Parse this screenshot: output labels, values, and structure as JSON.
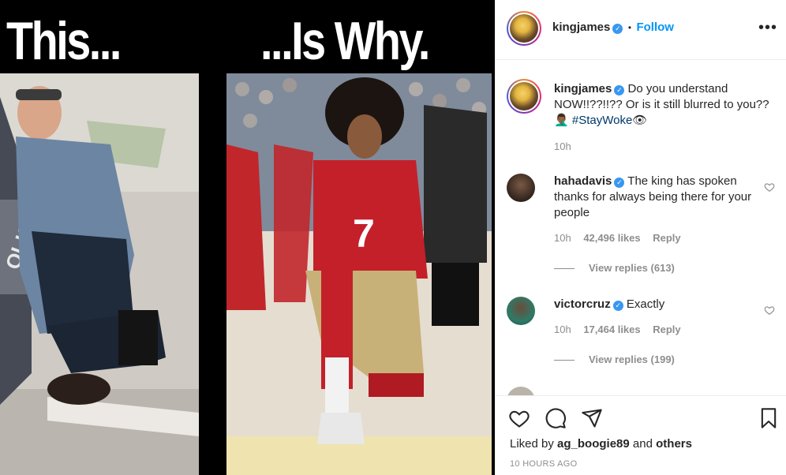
{
  "media": {
    "caption_left": "This...",
    "caption_right": "...Is Why.",
    "jersey_number": "7",
    "sign_text": "OLIS"
  },
  "post": {
    "username": "kingjames",
    "follow_label": "Follow",
    "separator": "•"
  },
  "comments": [
    {
      "username": "kingjames",
      "text": "Do you understand NOW!!??!!?? Or is it still blurred to you??",
      "hashtag": "#StayWoke",
      "time": "10h"
    },
    {
      "username": "hahadavis",
      "text": "The king has spoken thanks for always being there for your people",
      "time": "10h",
      "likes": "42,496 likes",
      "reply_label": "Reply",
      "view_replies": "View replies (613)"
    },
    {
      "username": "victorcruz",
      "text": "Exactly",
      "time": "10h",
      "likes": "17,464 likes",
      "reply_label": "Reply",
      "view_replies": "View replies (199)"
    }
  ],
  "likes_line": {
    "prefix": "Liked by",
    "user": "ag_boogie89",
    "middle": "and",
    "others": "others"
  },
  "timestamp": "10 HOURS AGO",
  "colors": {
    "link_blue": "#0095f6",
    "verified_blue": "#3897f0",
    "muted_gray": "#8e8e8e"
  },
  "icons": [
    "heart-icon",
    "comment-icon",
    "share-icon",
    "bookmark-icon",
    "more-options-icon",
    "verified-badge-icon"
  ]
}
